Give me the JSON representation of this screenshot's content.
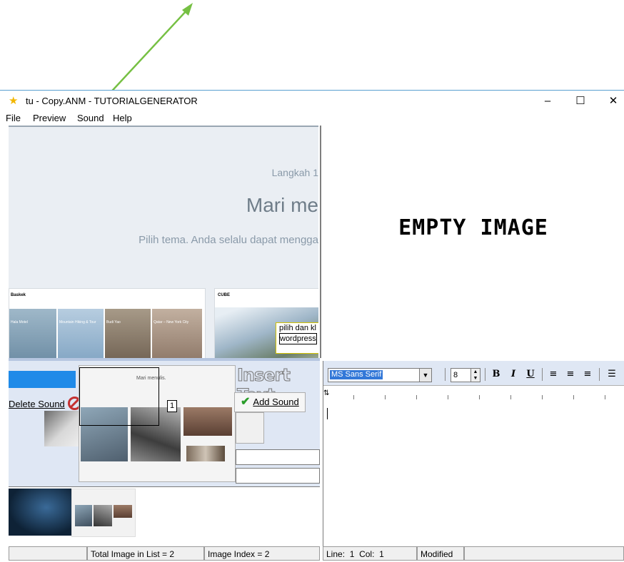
{
  "window": {
    "title": "tu - Copy.ANM - TUTORIALGENERATOR",
    "app_icon": "star-icon",
    "controls": {
      "minimize": "–",
      "maximize": "☐",
      "close": "✕"
    }
  },
  "menu": [
    "File",
    "Preview",
    "Sound",
    "Help"
  ],
  "preview": {
    "step": "Langkah 1",
    "headline": "Mari me",
    "subtext": "Pilih tema. Anda selalu dapat mengga",
    "card1_title": "Baskek",
    "card2_title": "CUBE",
    "card1_labels": [
      "Hala Motel",
      "Mountain Hiking & Tour",
      "Budi Yao",
      "Qatar – New York City"
    ],
    "overlay_text": [
      "pilih dan kl",
      "wordpress"
    ]
  },
  "empty_image": {
    "label": "EMPTY IMAGE"
  },
  "tools": {
    "delete_sound": "Delete Sound",
    "insert_text": "Insert Text",
    "add_sound": "Add Sound",
    "thumb_index": "1",
    "thumb_heading": "Mari menulis."
  },
  "editor": {
    "font": "MS Sans Serif",
    "size": "8",
    "bold": "B",
    "italic": "I",
    "underline": "U"
  },
  "status": {
    "total": "Total Image in List = 2",
    "index": "Image Index = 2",
    "line_label": "Line:",
    "line_value": "1",
    "col_label": "Col:",
    "col_value": "1",
    "modified": "Modified"
  },
  "colors": {
    "annotation_arrow": "#76c043",
    "selection_blue": "#1f8ae8",
    "panel_background": "#dfe7f4"
  }
}
